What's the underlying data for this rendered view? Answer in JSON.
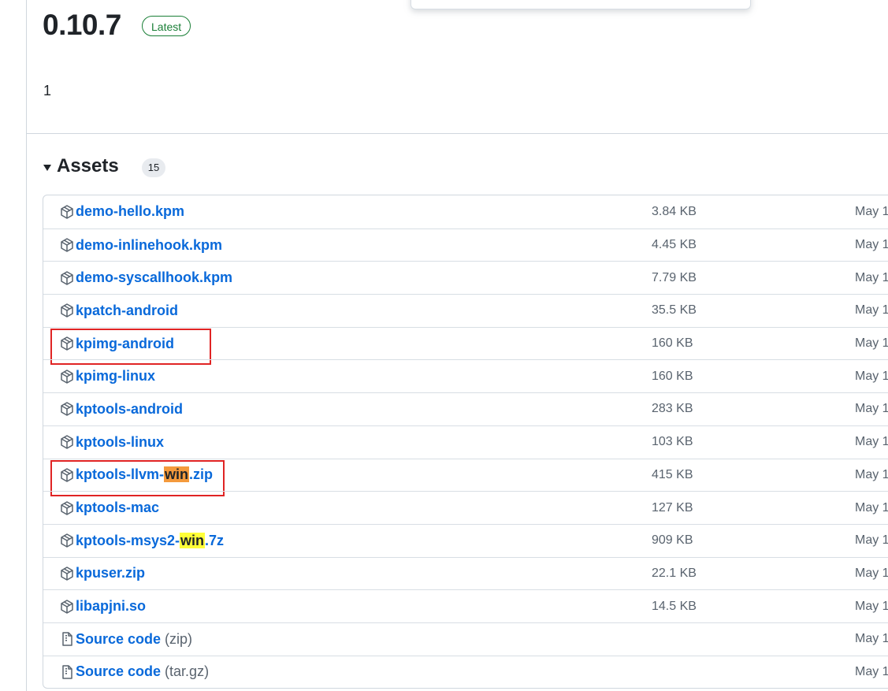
{
  "release": {
    "title": "0.10.7",
    "badge": "Latest",
    "body": "1"
  },
  "assets": {
    "title": "Assets",
    "count": "15",
    "items": [
      {
        "name": "demo-hello.kpm",
        "size": "3.84 KB",
        "date": "May 1",
        "icon": "package-icon"
      },
      {
        "name": "demo-inlinehook.kpm",
        "size": "4.45 KB",
        "date": "May 1",
        "icon": "package-icon"
      },
      {
        "name": "demo-syscallhook.kpm",
        "size": "7.79 KB",
        "date": "May 1",
        "icon": "package-icon"
      },
      {
        "name": "kpatch-android",
        "size": "35.5 KB",
        "date": "May 1",
        "icon": "package-icon"
      },
      {
        "name": "kpimg-android",
        "size": "160 KB",
        "date": "May 1",
        "icon": "package-icon",
        "boxed": true
      },
      {
        "name": "kpimg-linux",
        "size": "160 KB",
        "date": "May 1",
        "icon": "package-icon"
      },
      {
        "name": "kptools-android",
        "size": "283 KB",
        "date": "May 1",
        "icon": "package-icon"
      },
      {
        "name": "kptools-linux",
        "size": "103 KB",
        "date": "May 1",
        "icon": "package-icon"
      },
      {
        "name_parts": [
          "kptools-llvm-",
          "win",
          ".zip"
        ],
        "highlight": "#f49a3c",
        "size": "415 KB",
        "date": "May 1",
        "icon": "package-icon",
        "boxed": true
      },
      {
        "name": "kptools-mac",
        "size": "127 KB",
        "date": "May 1",
        "icon": "package-icon"
      },
      {
        "name_parts": [
          "kptools-msys2-",
          "win",
          ".7z"
        ],
        "highlight": "#ffff38",
        "size": "909 KB",
        "date": "May 1",
        "icon": "package-icon"
      },
      {
        "name": "kpuser.zip",
        "size": "22.1 KB",
        "date": "May 1",
        "icon": "package-icon"
      },
      {
        "name": "libapjni.so",
        "size": "14.5 KB",
        "date": "May 1",
        "icon": "package-icon"
      },
      {
        "name": "Source code",
        "ext": "(zip)",
        "size": "",
        "date": "May 1",
        "icon": "file-zip-icon"
      },
      {
        "name": "Source code",
        "ext": "(tar.gz)",
        "size": "",
        "date": "May 1",
        "icon": "file-zip-icon"
      }
    ]
  },
  "colors": {
    "link": "#0969da",
    "latest": "#1a7f37",
    "annotation": "#e02424"
  }
}
